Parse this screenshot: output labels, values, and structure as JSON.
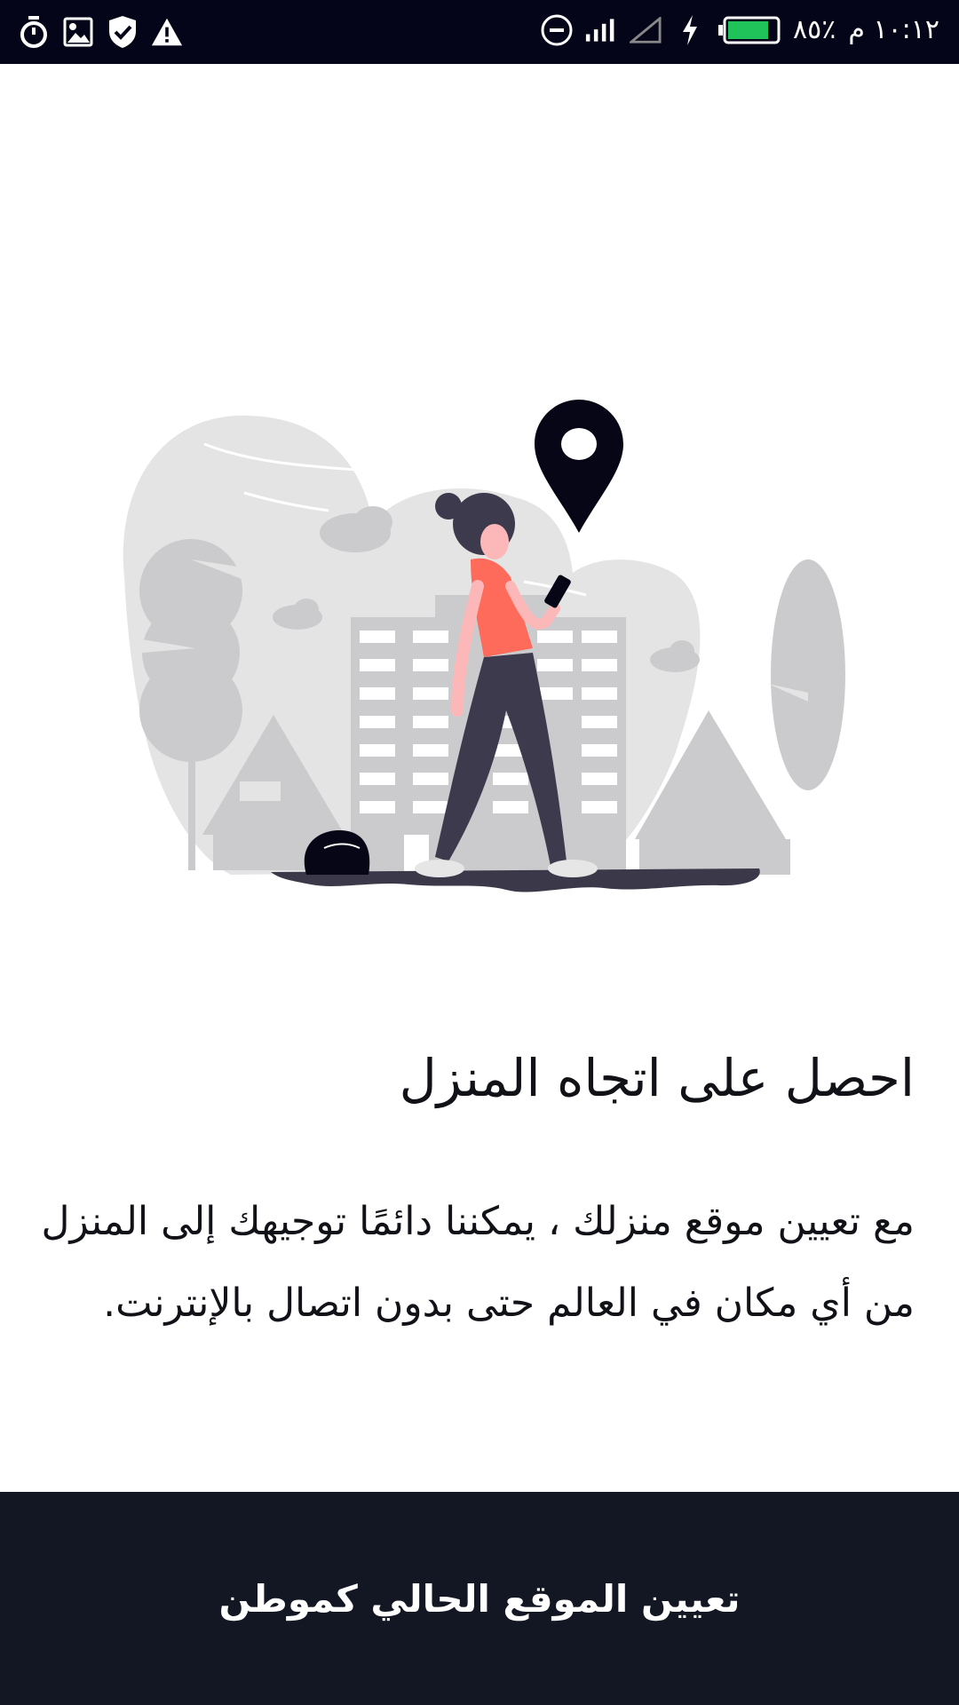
{
  "status_bar": {
    "time": "١٠:١٢ م",
    "battery_percent": "٨٥٪",
    "battery_level": 0.85,
    "left_icons": [
      "timer-icon",
      "image-icon",
      "shield-check-icon",
      "warning-icon"
    ],
    "right_icons": [
      "do-not-disturb-icon",
      "signal-icon",
      "no-signal-icon",
      "charging-icon",
      "battery-icon"
    ]
  },
  "illustration": {
    "description_icon": "location-pin-icon",
    "colors": {
      "blob": "#e4e4e4",
      "trees": "#cbcbcd",
      "pin": "#060617",
      "shirt": "#fe6b5b",
      "pants": "#3e3a4e",
      "ground": "#3b3849"
    }
  },
  "content": {
    "headline": "احصل على اتجاه المنزل",
    "body": "مع تعيين موقع منزلك ، يمكننا دائمًا توجيهك إلى المنزل من أي مكان في العالم حتى بدون اتصال بالإنترنت."
  },
  "cta": {
    "label": "تعيين الموقع الحالي كموطن",
    "color": "#131724"
  }
}
